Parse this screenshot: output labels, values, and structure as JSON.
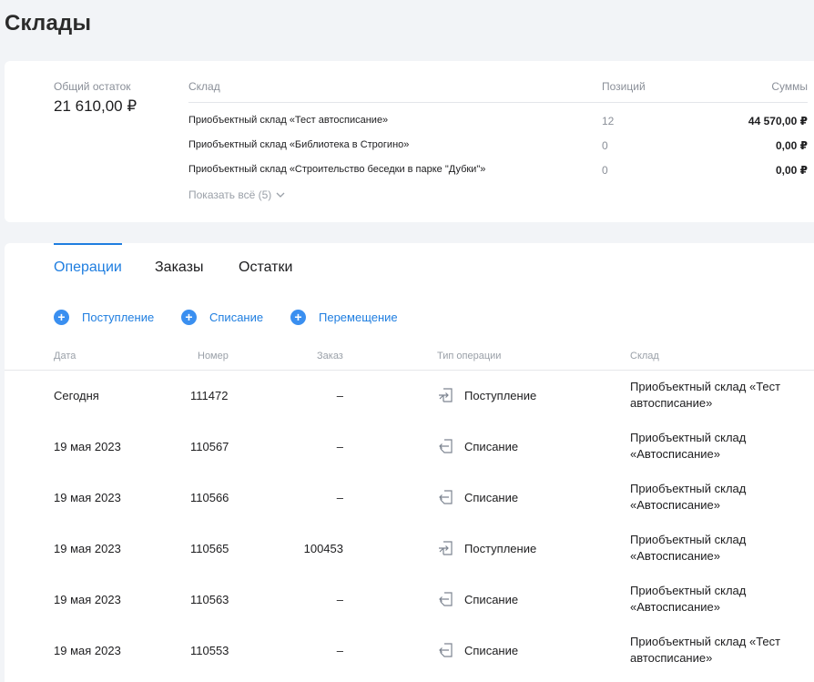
{
  "page": {
    "title": "Склады"
  },
  "summary": {
    "total_label": "Общий остаток",
    "total_value": "21 610,00 ₽",
    "columns": {
      "warehouse": "Склад",
      "positions": "Позиций",
      "sums": "Суммы"
    },
    "rows": [
      {
        "name": "Приобъектный склад «Тест автосписание»",
        "positions": "12",
        "sum": "44 570,00 ₽"
      },
      {
        "name": "Приобъектный склад «Библиотека в Строгино»",
        "positions": "0",
        "sum": "0,00 ₽"
      },
      {
        "name": "Приобъектный склад «Строительство беседки в парке \"Дубки\"»",
        "positions": "0",
        "sum": "0,00 ₽"
      }
    ],
    "show_all": "Показать всё (5)"
  },
  "tabs": [
    {
      "label": "Операции",
      "active": true
    },
    {
      "label": "Заказы",
      "active": false
    },
    {
      "label": "Остатки",
      "active": false
    }
  ],
  "actions": [
    {
      "label": "Поступление",
      "icon": "plus-circle-icon"
    },
    {
      "label": "Списание",
      "icon": "plus-circle-icon"
    },
    {
      "label": "Перемещение",
      "icon": "plus-circle-icon"
    }
  ],
  "operations": {
    "columns": {
      "date": "Дата",
      "number": "Номер",
      "order": "Заказ",
      "type": "Тип операции",
      "warehouse": "Склад"
    },
    "rows": [
      {
        "date": "Сегодня",
        "number": "111472",
        "order": "–",
        "type": "Поступление",
        "type_icon": "income-icon",
        "warehouse": "Приобъектный склад «Тест автосписание»"
      },
      {
        "date": "19 мая 2023",
        "number": "110567",
        "order": "–",
        "type": "Списание",
        "type_icon": "writeoff-icon",
        "warehouse": "Приобъектный склад «Автосписание»"
      },
      {
        "date": "19 мая 2023",
        "number": "110566",
        "order": "–",
        "type": "Списание",
        "type_icon": "writeoff-icon",
        "warehouse": "Приобъектный склад «Автосписание»"
      },
      {
        "date": "19 мая 2023",
        "number": "110565",
        "order": "100453",
        "type": "Поступление",
        "type_icon": "income-icon",
        "warehouse": "Приобъектный склад «Автосписание»"
      },
      {
        "date": "19 мая 2023",
        "number": "110563",
        "order": "–",
        "type": "Списание",
        "type_icon": "writeoff-icon",
        "warehouse": "Приобъектный склад «Автосписание»"
      },
      {
        "date": "19 мая 2023",
        "number": "110553",
        "order": "–",
        "type": "Списание",
        "type_icon": "writeoff-icon",
        "warehouse": "Приобъектный склад «Тест автосписание»"
      }
    ]
  },
  "colors": {
    "accent": "#1f7ee0",
    "plus_bg": "#3a8ff0",
    "muted": "#8a8f98"
  }
}
